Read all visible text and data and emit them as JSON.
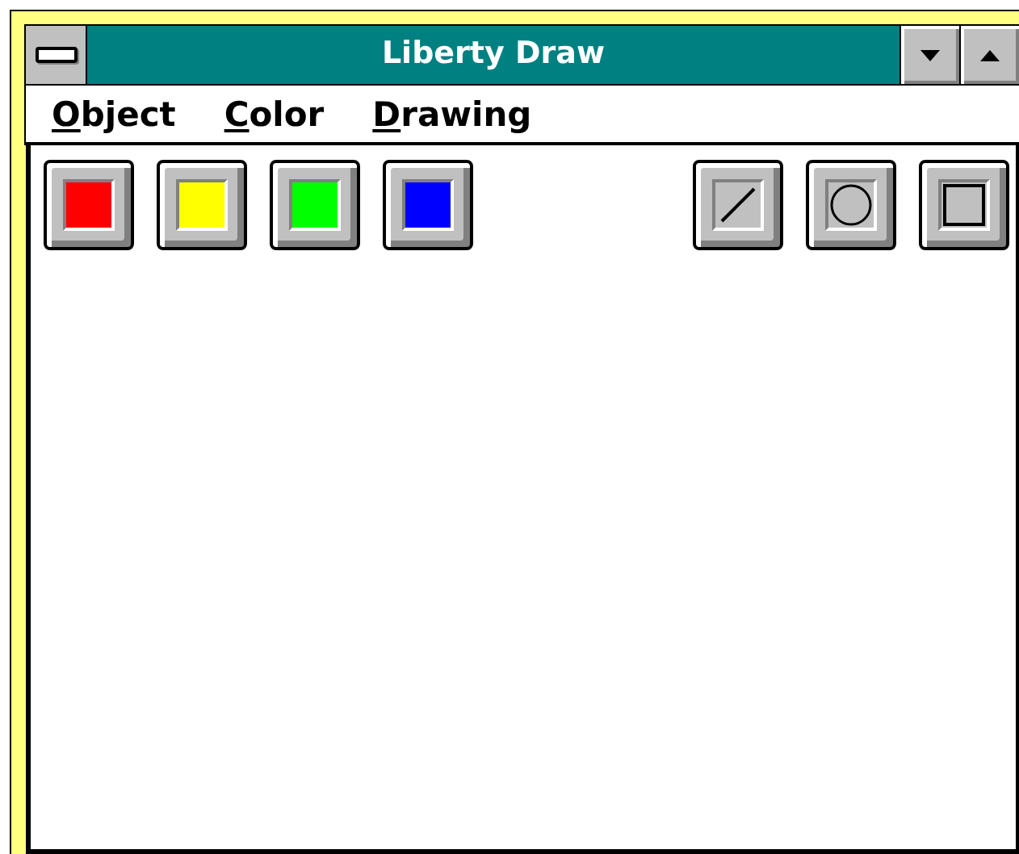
{
  "window": {
    "title": "Liberty Draw"
  },
  "menu": [
    {
      "accel": "O",
      "rest": "bject"
    },
    {
      "accel": "C",
      "rest": "olor"
    },
    {
      "accel": "D",
      "rest": "rawing"
    }
  ],
  "color_buttons": [
    {
      "color": "#ff0000"
    },
    {
      "color": "#ffff00"
    },
    {
      "color": "#00ff00"
    },
    {
      "color": "#0000ff"
    }
  ],
  "tool_buttons": [
    {
      "kind": "line"
    },
    {
      "kind": "circle"
    },
    {
      "kind": "rectangle"
    }
  ]
}
